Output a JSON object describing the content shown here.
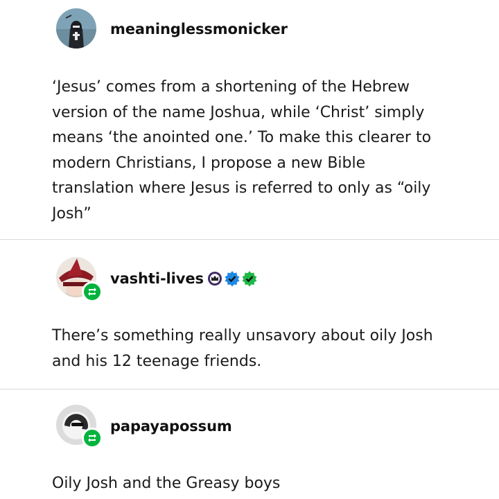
{
  "posts": [
    {
      "username": "meaninglessmonicker",
      "avatar_icon": "hooded-figure-avatar",
      "reblog": false,
      "body_lines": [
        "‘Jesus’ comes from a shortening of the Hebrew",
        "version of the name Joshua, while ‘Christ’ simply",
        "means ‘the anointed one.’ To make this clearer to",
        "modern Christians, I propose a new Bible",
        "translation where Jesus is referred to only as “oily",
        "Josh”"
      ]
    },
    {
      "username": "vashti-lives",
      "avatar_icon": "witch-hat-avatar",
      "reblog": true,
      "badges": [
        "crown-badge-icon",
        "blue-verified-badge-icon",
        "green-verified-badge-icon"
      ],
      "body_lines": [
        "There’s something really unsavory about oily Josh",
        "and his 12 teenage friends."
      ]
    },
    {
      "username": "papayapossum",
      "avatar_icon": "possum-sunglasses-avatar",
      "reblog": true,
      "body_lines": [
        "Oily Josh and the Greasy boys"
      ]
    }
  ],
  "colors": {
    "reblog_green": "#00b33c",
    "divider": "#d9d9d9",
    "text": "#1a1a1a"
  }
}
